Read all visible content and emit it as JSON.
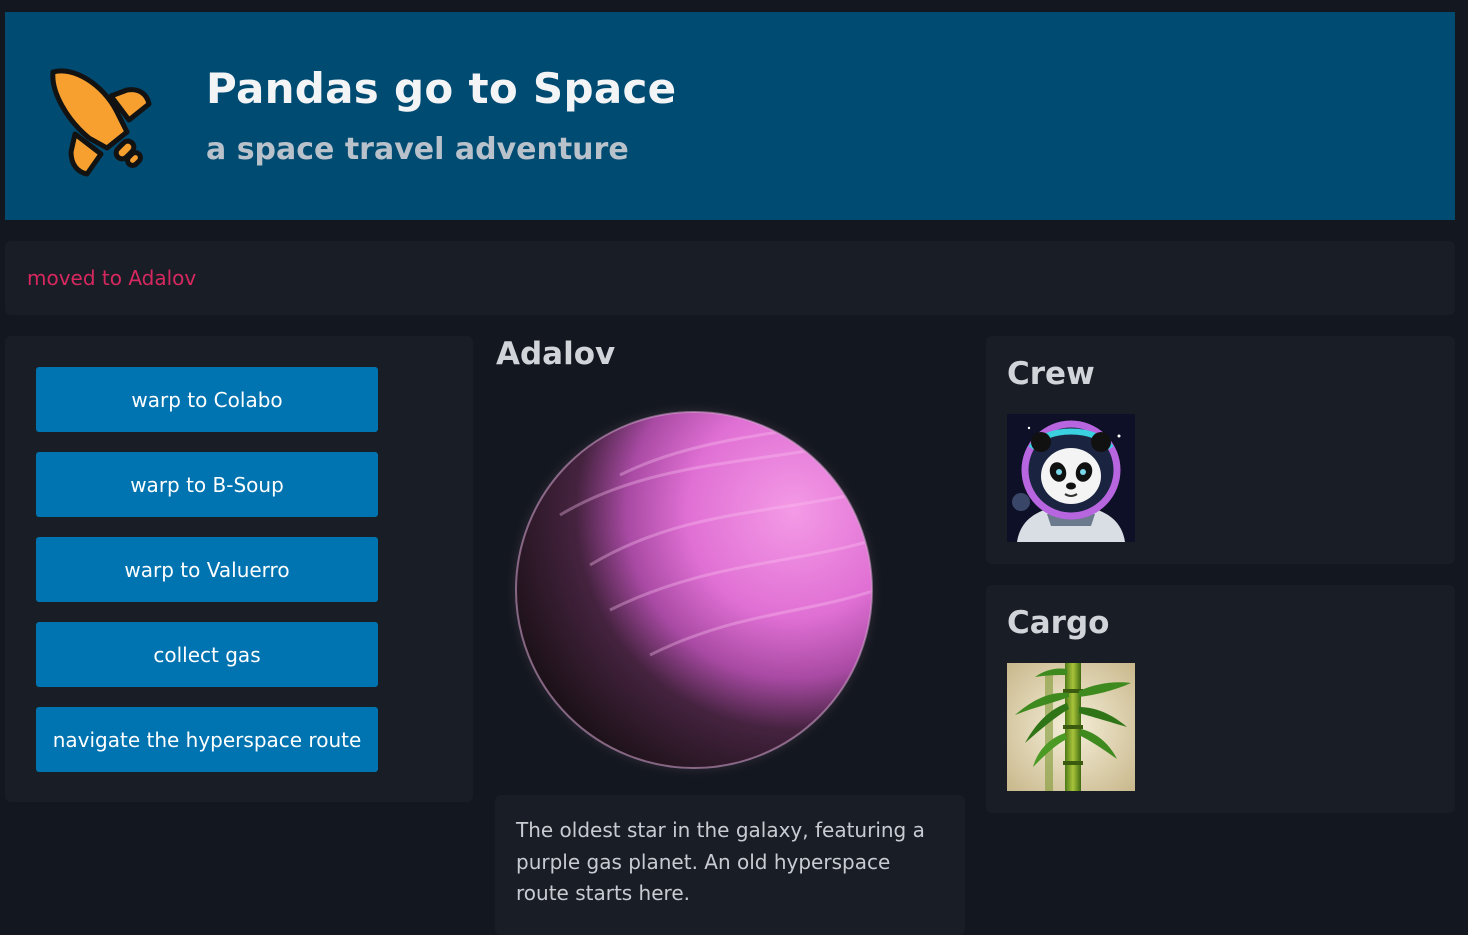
{
  "header": {
    "title": "Pandas go to Space",
    "subtitle": "a space travel adventure",
    "logo_icon": "rocket-icon",
    "background_color": "#004b72",
    "logo_color": "#f7a02f"
  },
  "status": {
    "message": "moved to Adalov",
    "color": "#d6285f"
  },
  "actions": [
    {
      "label": "warp to Colabo"
    },
    {
      "label": "warp to B-Soup"
    },
    {
      "label": "warp to Valuerro"
    },
    {
      "label": "collect gas"
    },
    {
      "label": "navigate the hyperspace route"
    }
  ],
  "button_color": "#0073b1",
  "planet": {
    "name": "Adalov",
    "image": "pink-gas-planet",
    "description": "The oldest star in the galaxy, featuring a purple gas planet. An old hyperspace route starts here."
  },
  "crew": {
    "title": "Crew",
    "members": [
      {
        "image": "astronaut-panda-portrait"
      }
    ]
  },
  "cargo": {
    "title": "Cargo",
    "items": [
      {
        "image": "bamboo-stalk"
      }
    ]
  }
}
